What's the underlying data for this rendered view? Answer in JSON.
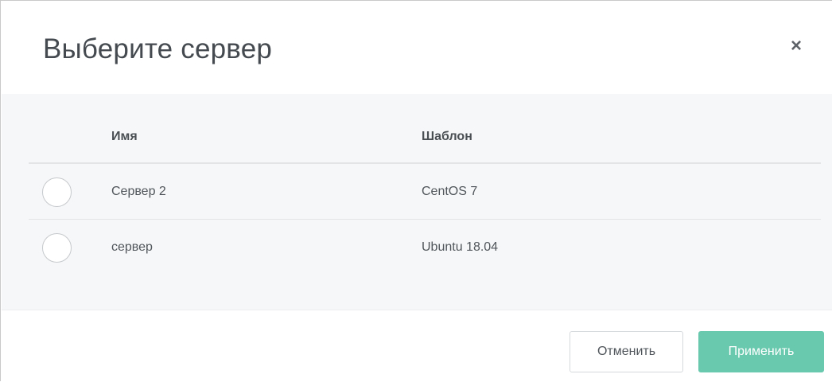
{
  "dialog": {
    "title": "Выберите сервер",
    "close_symbol": "×"
  },
  "table": {
    "columns": {
      "name": "Имя",
      "template": "Шаблон"
    },
    "rows": [
      {
        "name": "Сервер 2",
        "template": "CentOS 7",
        "selected": false
      },
      {
        "name": "сервер",
        "template": "Ubuntu 18.04",
        "selected": false
      }
    ]
  },
  "footer": {
    "cancel_label": "Отменить",
    "apply_label": "Применить"
  },
  "colors": {
    "accent": "#69c9ae",
    "body_background": "#f6f7f8"
  }
}
